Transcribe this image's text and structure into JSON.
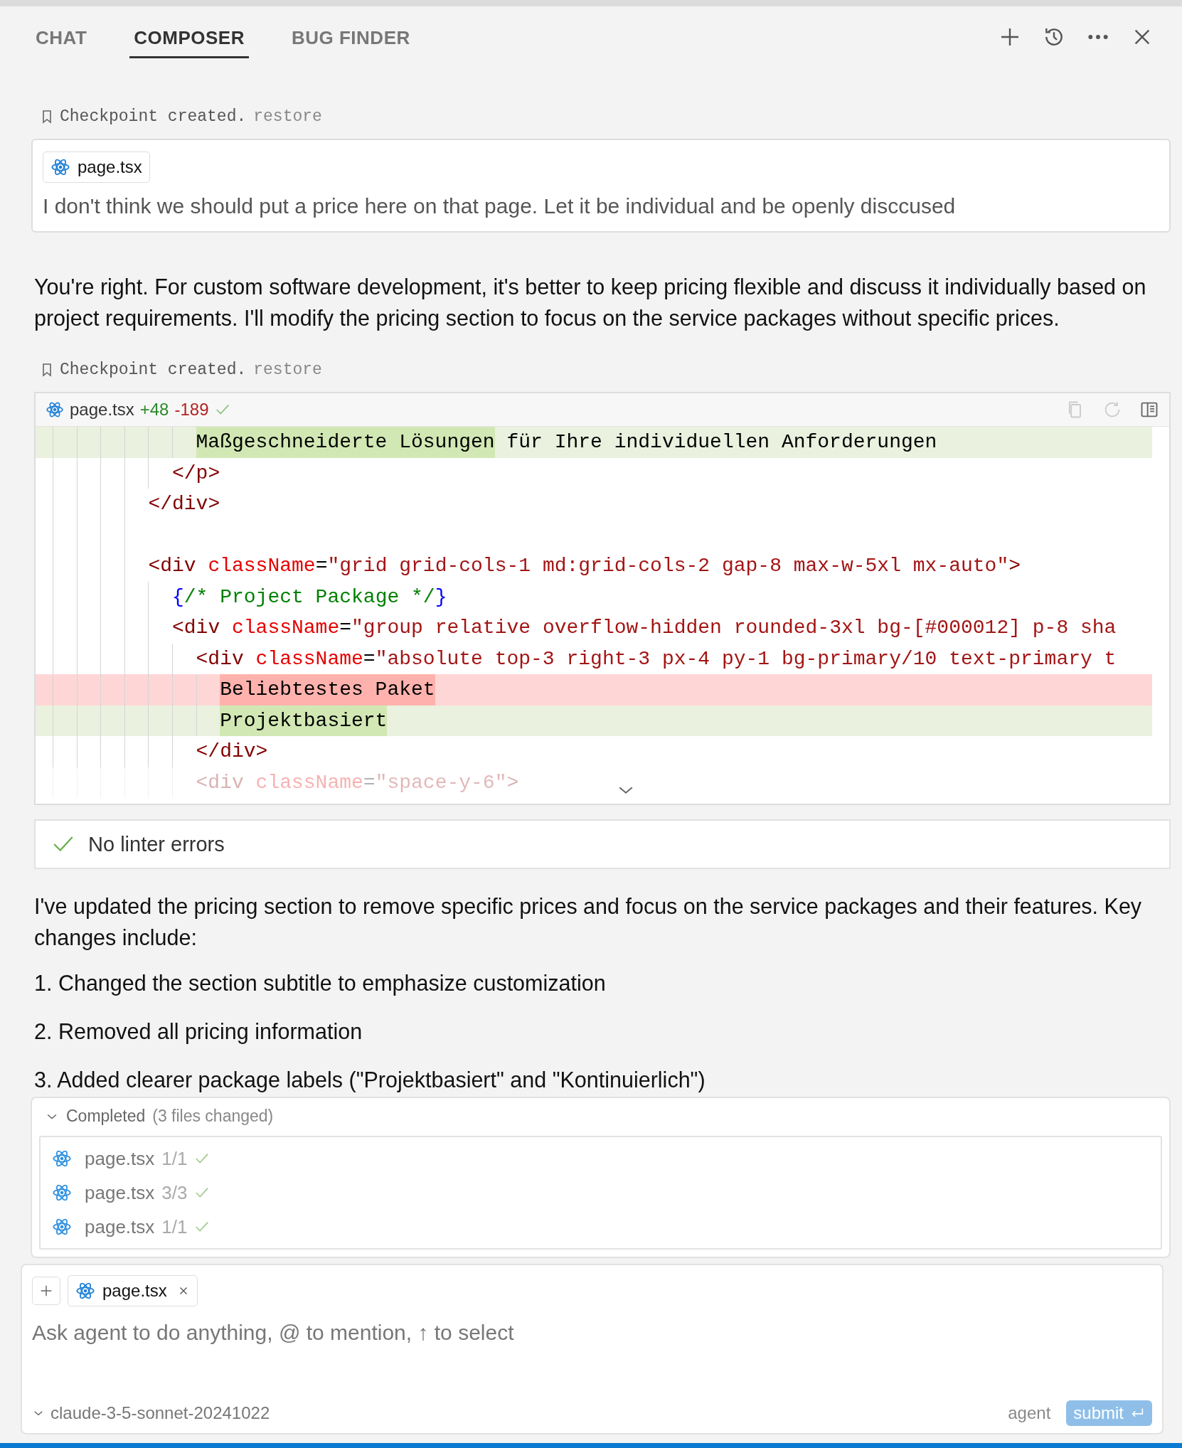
{
  "tabs": [
    {
      "label": "CHAT",
      "selected": false
    },
    {
      "label": "COMPOSER",
      "selected": true
    },
    {
      "label": "BUG FINDER",
      "selected": false
    }
  ],
  "messages": [
    {
      "kind": "checkpoint",
      "text": "Checkpoint created.",
      "link": "restore"
    },
    {
      "kind": "user",
      "file": "page.tsx",
      "text": "I don't think we should put a price here on that page. Let it be individual and be openly disccused"
    },
    {
      "kind": "assistant",
      "text": "You're right. For custom software development, it's better to keep pricing flexible and discuss it individually based on project requirements. I'll modify the pricing section to focus on the service packages without specific prices."
    },
    {
      "kind": "checkpoint",
      "text": "Checkpoint created.",
      "link": "restore"
    },
    {
      "kind": "diff",
      "file": "page.tsx",
      "added": "+48",
      "removed": "-189",
      "accepted": true,
      "lines": [
        {
          "added": true,
          "removed": false,
          "faded": false,
          "blank": false,
          "tokens": [
            {
              "kind": "plain",
              "text": "            Maßgeschneiderte Lösungen",
              "changed": true
            },
            {
              "kind": "plain",
              "text": " für Ihre individuellen Anforderungen",
              "changed": false
            }
          ]
        },
        {
          "added": false,
          "removed": false,
          "faded": false,
          "blank": false,
          "tokens": [
            {
              "kind": "tag",
              "text": "          </p>",
              "changed": false
            }
          ]
        },
        {
          "added": false,
          "removed": false,
          "faded": false,
          "blank": false,
          "tokens": [
            {
              "kind": "tag",
              "text": "        </div>",
              "changed": false
            }
          ]
        },
        {
          "added": false,
          "removed": false,
          "faded": false,
          "blank": true
        },
        {
          "added": false,
          "removed": false,
          "faded": false,
          "blank": false,
          "tokens": [
            {
              "kind": "tag",
              "text": "        <div ",
              "changed": false
            },
            {
              "kind": "attr",
              "text": "className",
              "changed": false
            },
            {
              "kind": "plain",
              "text": "=",
              "changed": false
            },
            {
              "kind": "string",
              "text": "\"grid grid-cols-1 md:grid-cols-2 gap-8 max-w-5xl mx-auto\"",
              "changed": false
            },
            {
              "kind": "tag",
              "text": ">",
              "changed": false
            }
          ]
        },
        {
          "added": false,
          "removed": false,
          "faded": false,
          "blank": false,
          "tokens": [
            {
              "kind": "brace",
              "text": "          {",
              "changed": false
            },
            {
              "kind": "comment",
              "text": "/* Project Package */",
              "changed": false
            },
            {
              "kind": "brace",
              "text": "}",
              "changed": false
            }
          ]
        },
        {
          "added": false,
          "removed": false,
          "faded": false,
          "blank": false,
          "tokens": [
            {
              "kind": "tag",
              "text": "          <div ",
              "changed": false
            },
            {
              "kind": "attr",
              "text": "className",
              "changed": false
            },
            {
              "kind": "plain",
              "text": "=",
              "changed": false
            },
            {
              "kind": "string",
              "text": "\"group relative overflow-hidden rounded-3xl bg-[#000012] p-8 sha",
              "changed": false
            }
          ]
        },
        {
          "added": false,
          "removed": false,
          "faded": false,
          "blank": false,
          "tokens": [
            {
              "kind": "tag",
              "text": "            <div ",
              "changed": false
            },
            {
              "kind": "attr",
              "text": "className",
              "changed": false
            },
            {
              "kind": "plain",
              "text": "=",
              "changed": false
            },
            {
              "kind": "string",
              "text": "\"absolute top-3 right-3 px-4 py-1 bg-primary/10 text-primary t",
              "changed": false
            }
          ]
        },
        {
          "added": false,
          "removed": true,
          "faded": false,
          "blank": false,
          "tokens": [
            {
              "kind": "plain",
              "text": "              Beliebtestes Paket",
              "changed": true
            }
          ]
        },
        {
          "added": true,
          "removed": false,
          "faded": false,
          "blank": false,
          "tokens": [
            {
              "kind": "plain",
              "text": "              Projektbasiert",
              "changed": true
            }
          ]
        },
        {
          "added": false,
          "removed": false,
          "faded": false,
          "blank": false,
          "tokens": [
            {
              "kind": "tag",
              "text": "            </div>",
              "changed": false
            }
          ]
        },
        {
          "added": false,
          "removed": false,
          "faded": true,
          "blank": false,
          "tokens": [
            {
              "kind": "tag",
              "text": "            <div ",
              "changed": false
            },
            {
              "kind": "attr",
              "text": "className",
              "changed": false
            },
            {
              "kind": "plain",
              "text": "=",
              "changed": false
            },
            {
              "kind": "string",
              "text": "\"space-y-6\"",
              "changed": false
            },
            {
              "kind": "tag",
              "text": ">",
              "changed": false
            }
          ]
        }
      ]
    },
    {
      "kind": "linter",
      "text": "No linter errors"
    },
    {
      "kind": "assistant",
      "text": "I've updated the pricing section to remove specific prices and focus on the service packages and their features. Key changes include:"
    },
    {
      "kind": "list_item",
      "text": "1. Changed the section subtitle to emphasize customization"
    },
    {
      "kind": "list_item",
      "text": "2. Removed all pricing information"
    },
    {
      "kind": "list_item",
      "text": "3. Added clearer package labels (\"Projektbasiert\" and \"Kontinuierlich\")"
    }
  ],
  "completed": {
    "expanded": true,
    "title": "Completed",
    "count": "(3 files changed)",
    "files": [
      {
        "name": "page.tsx",
        "progress": "1/1"
      },
      {
        "name": "page.tsx",
        "progress": "3/3"
      },
      {
        "name": "page.tsx",
        "progress": "1/1"
      }
    ]
  },
  "composer": {
    "attachments": [
      {
        "name": "page.tsx"
      }
    ],
    "placeholder": "Ask agent to do anything, @ to mention, ↑ to select",
    "model": "claude-3-5-sonnet-20241022",
    "mode": "agent",
    "submit": "submit"
  }
}
